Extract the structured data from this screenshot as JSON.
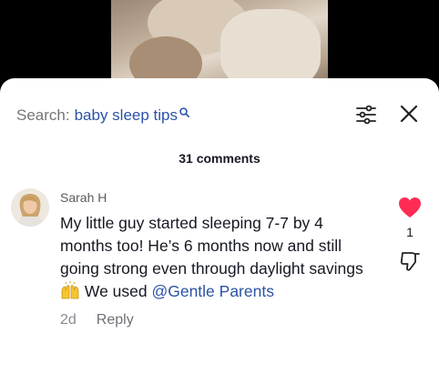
{
  "search": {
    "prefix": "Search:",
    "term": "baby sleep tips",
    "icon": "search-icon"
  },
  "header": {
    "filter_icon": "sliders-icon",
    "close_icon": "close-icon"
  },
  "comments": {
    "count_label": "31 comments",
    "items": [
      {
        "username": "Sarah H",
        "text_main": "My little guy started sleeping 7-7 by 4 months too! He’s 6 months now and still going strong even through daylight savings",
        "emoji": "raising-hands-emoji",
        "text_after": " We used ",
        "mention": "@Gentle Parents",
        "age": "2d",
        "reply_label": "Reply",
        "likes": "1",
        "liked": true
      }
    ]
  },
  "colors": {
    "like_red": "#fe2c55",
    "link_blue": "#2b52a6"
  }
}
